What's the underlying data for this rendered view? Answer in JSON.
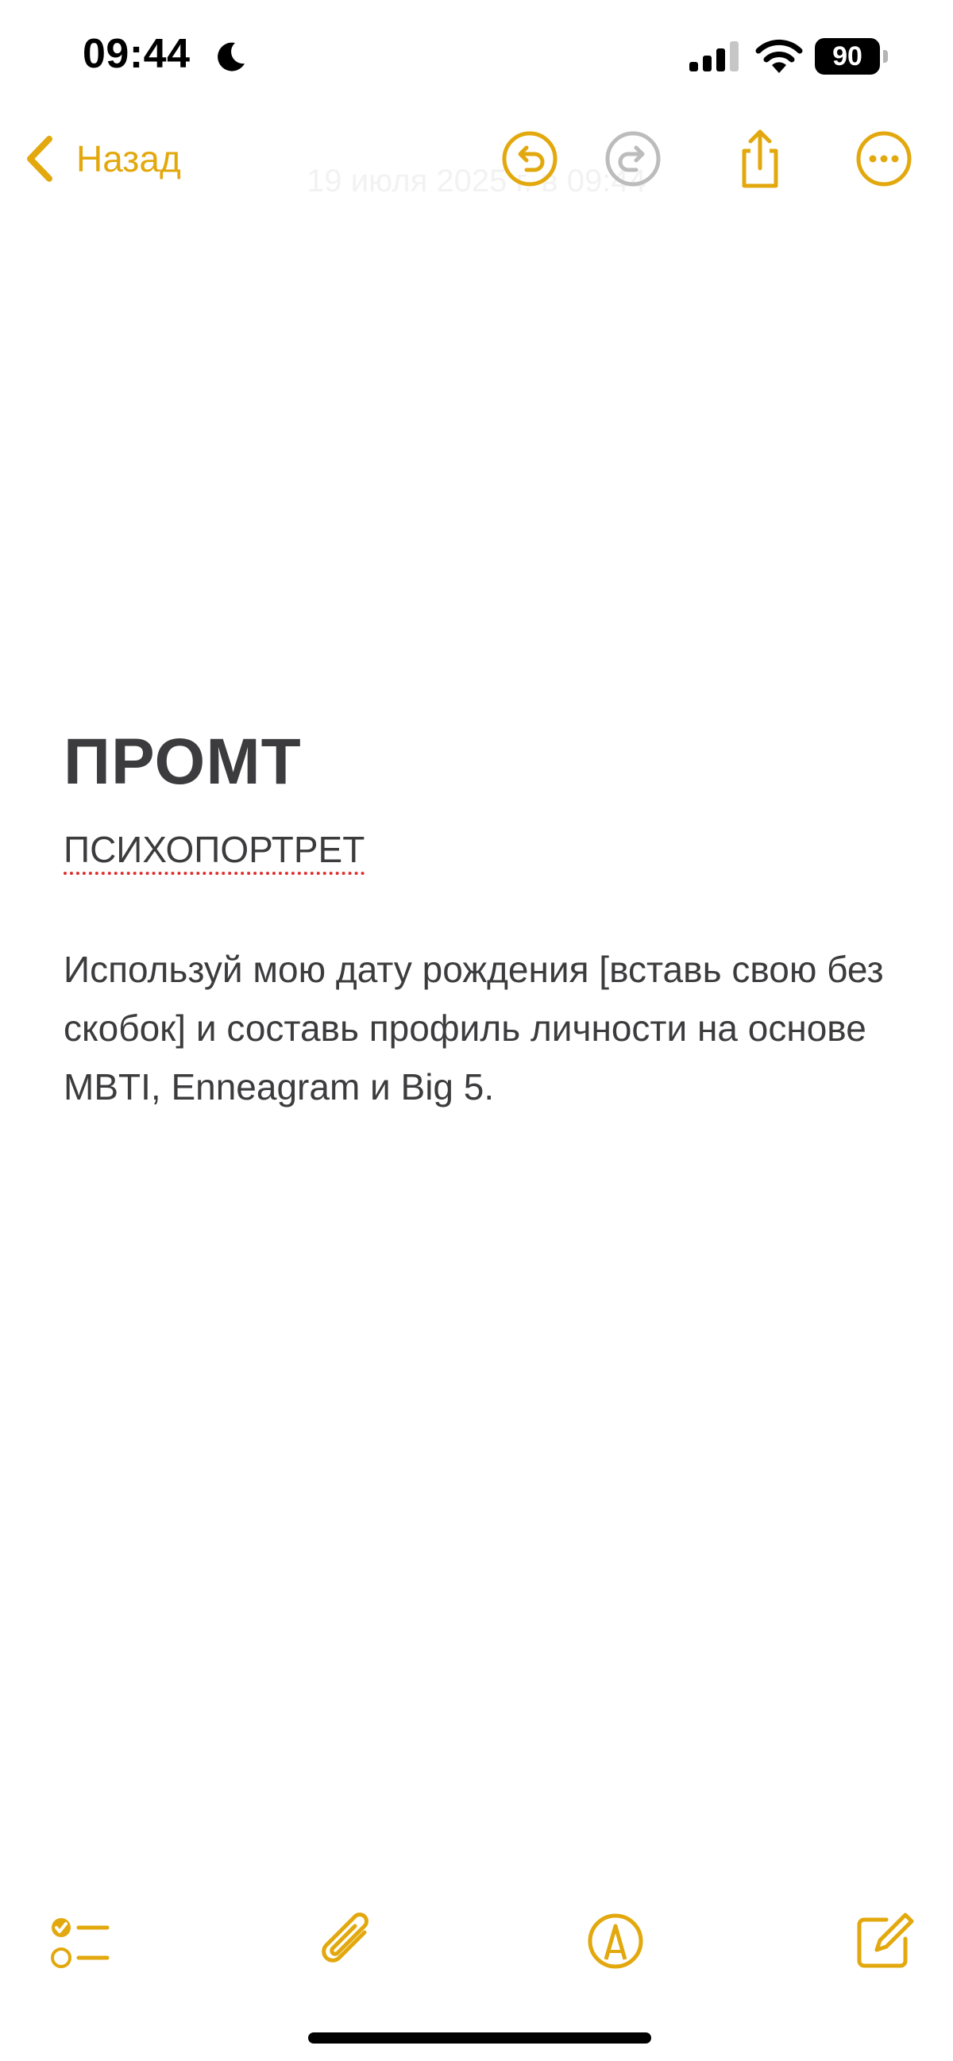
{
  "status_bar": {
    "time": "09:44",
    "battery": "90",
    "icons": [
      "moon-icon",
      "cellular-signal-icon",
      "wifi-icon",
      "battery-icon"
    ]
  },
  "nav": {
    "back_label": "Назад",
    "date_ghost": "19 июля 2025 г. в 09:44",
    "icons": [
      "chevron-left-icon",
      "undo-icon",
      "redo-icon",
      "share-icon",
      "more-icon"
    ]
  },
  "note": {
    "title": "ПРОМТ",
    "subtitle": "ПСИХОПОРТРЕТ",
    "body": "Используй мою дату рождения [вставь свою без скобок] и составь профиль личности на основе MBTI, Enneagram и Big 5."
  },
  "toolbar": {
    "icons": [
      "checklist-icon",
      "paperclip-icon",
      "markup-icon",
      "compose-icon"
    ]
  },
  "colors": {
    "accent": "#e2a80d",
    "text": "#3c3c3e",
    "disabled": "#bcbcbc",
    "spellcheck": "#e03030"
  }
}
